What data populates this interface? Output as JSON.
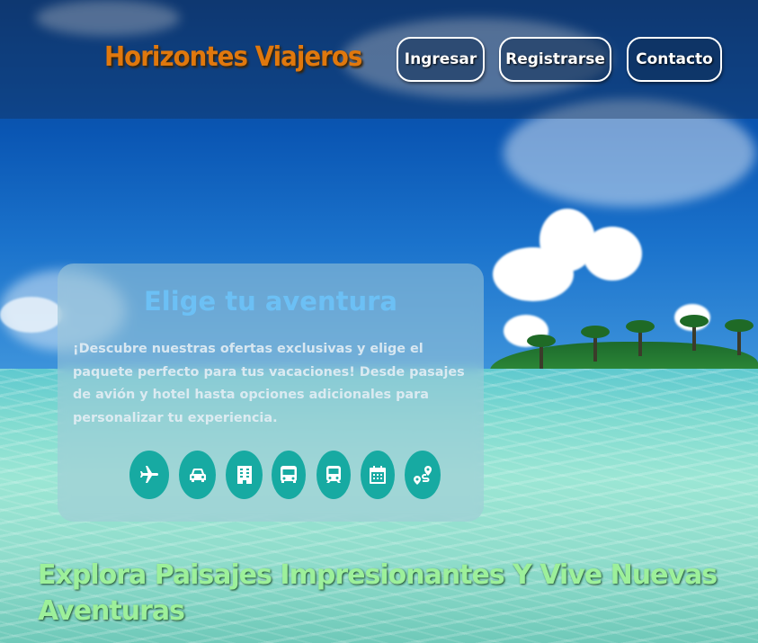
{
  "header": {
    "brand": "Horizontes Viajeros",
    "nav": [
      {
        "label": "Ingresar"
      },
      {
        "label": "Registrarse"
      },
      {
        "label": "Contacto"
      }
    ]
  },
  "card": {
    "title": "Elige tu aventura",
    "description": "¡Descubre nuestras ofertas exclusivas y elige el paquete perfecto para tus vacaciones! Desde pasajes de avión y hotel hasta opciones adicionales para personalizar tu experiencia.",
    "services": [
      {
        "icon": "plane-icon"
      },
      {
        "icon": "car-icon"
      },
      {
        "icon": "hotel-icon"
      },
      {
        "icon": "bus-icon"
      },
      {
        "icon": "train-icon"
      },
      {
        "icon": "calendar-icon"
      },
      {
        "icon": "route-icon"
      }
    ]
  },
  "tagline": "Explora Paisajes Impresionantes Y Vive Nuevas Aventuras",
  "colors": {
    "brand": "#e0780d",
    "accent": "#17aaa2",
    "card_title": "#6cc0f5",
    "tagline": "#9df09a"
  }
}
